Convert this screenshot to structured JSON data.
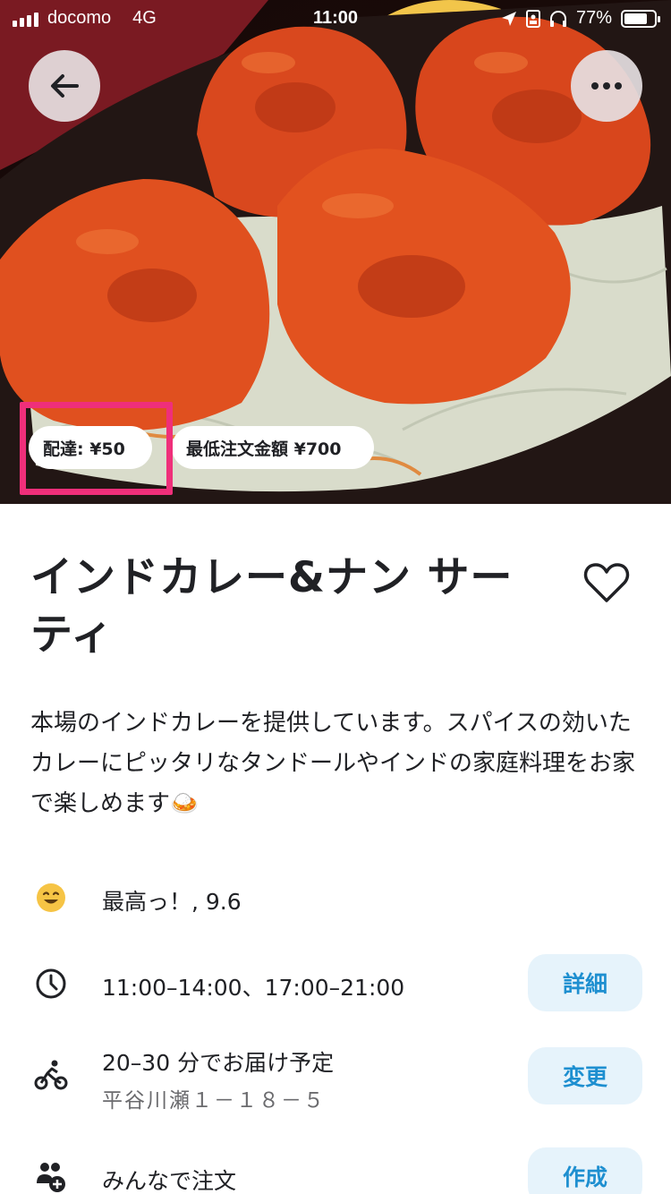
{
  "status_bar": {
    "carrier": "docomo",
    "network": "4G",
    "time": "11:00",
    "battery": "77%",
    "battery_level": 0.77
  },
  "header": {
    "back_icon": "back-arrow-icon",
    "more_icon": "more-dots-icon"
  },
  "badges": {
    "delivery_fee": "配達: ¥50",
    "minimum_order": "最低注文金額 ¥700"
  },
  "restaurant": {
    "name": "インドカレー&ナン サーティ",
    "description": "本場のインドカレーを提供しています。スパイスの効いたカレーにピッタリなタンドールやインドの家庭料理をお家で楽しめます🍛"
  },
  "info_rows": {
    "rating": {
      "icon": "smile-face-icon",
      "text": "最高っ！, 9.6"
    },
    "hours": {
      "icon": "clock-icon",
      "text": "11:00–14:00、17:00–21:00",
      "action": "詳細"
    },
    "delivery": {
      "icon": "cyclist-icon",
      "text": "20–30 分でお届け予定",
      "address": "平谷川瀬１－１８－５",
      "action": "変更"
    },
    "group_order": {
      "icon": "group-add-icon",
      "text": "みんなで注文",
      "action": "作成"
    }
  },
  "colors": {
    "accent_blue": "#1e8fd0",
    "action_bg": "#e6f3fb",
    "highlight_pink": "#ef2f7a"
  }
}
